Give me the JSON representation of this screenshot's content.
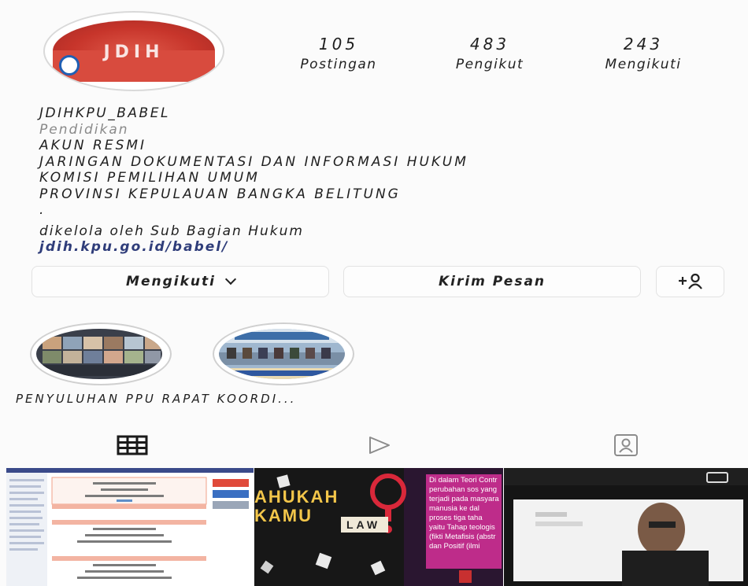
{
  "stats": [
    {
      "value": "105",
      "label": "Postingan"
    },
    {
      "value": "483",
      "label": "Pengikut"
    },
    {
      "value": "243",
      "label": "Mengikuti"
    }
  ],
  "profile": {
    "avatar_text": "JDIH",
    "username": "JDIHKPU_BABEL",
    "category": "Pendidikan",
    "bio_lines": [
      "AKUN RESMI",
      "JARINGAN DOKUMENTASI DAN INFORMASI HUKUM",
      "KOMISI PEMILIHAN UMUM",
      "PROVINSI KEPULAUAN BANGKA BELITUNG",
      "."
    ],
    "managed_by": "dikelola oleh Sub Bagian Hukum",
    "link": "jdih.kpu.go.id/babel/"
  },
  "actions": {
    "following_label": "Mengikuti",
    "message_label": "Kirim Pesan",
    "add_person_icon": "add-person-icon"
  },
  "highlights": {
    "captions": "PENYULUHAN PPU RAPAT KOORDI..."
  },
  "tabs": [
    {
      "icon": "grid-icon"
    },
    {
      "icon": "reels-icon"
    },
    {
      "icon": "tagged-icon"
    }
  ],
  "posts": [
    {
      "alt": "document-post"
    },
    {
      "alt": "poster-post",
      "text1": "AHUKAH",
      "text2": "KAMU",
      "law": "LAW",
      "side_text": "Di dalam Teori Contr perubahan sos yang terjadi pada masyara manusia ke dal proses tiga taha yaitu Tahap teologis (fikti Metafisis (abstr dan Positif (ilmi"
    },
    {
      "alt": "video-call-post"
    }
  ],
  "colors": {
    "link": "#2f3d7a",
    "category": "#8a8a8a",
    "border": "#e2e2e2"
  }
}
